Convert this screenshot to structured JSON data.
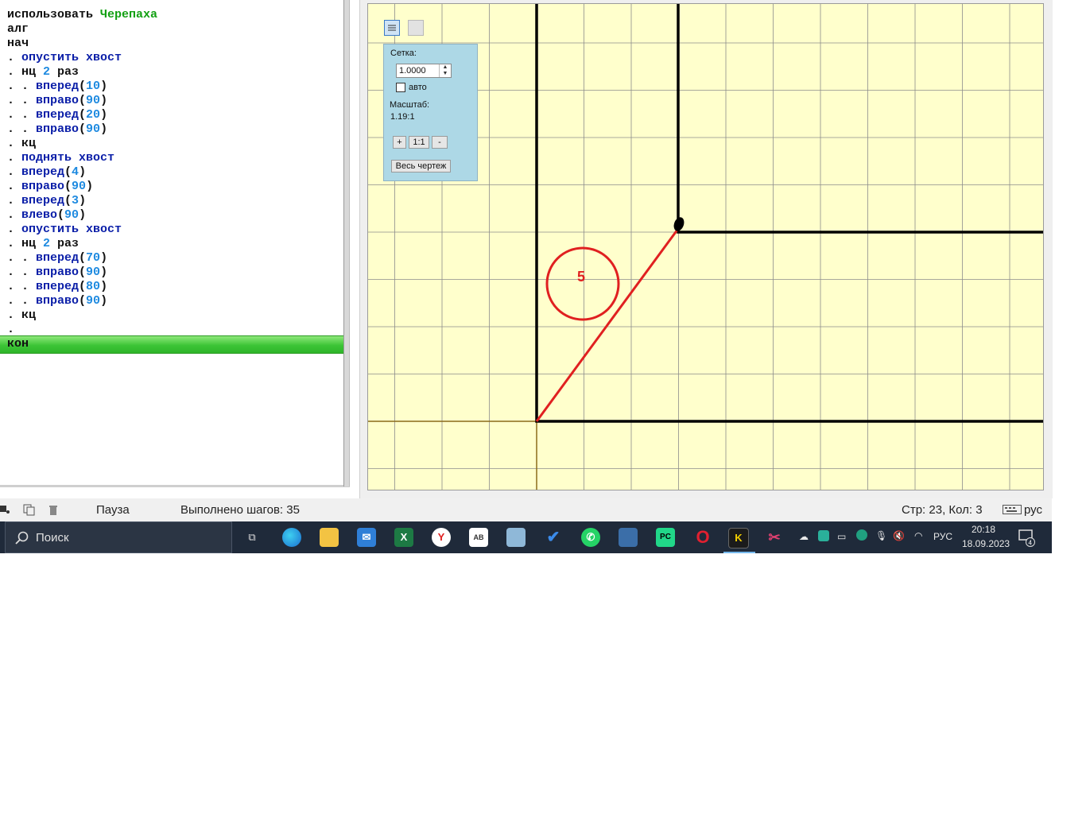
{
  "editor": {
    "lines": [
      [
        {
          "t": "использовать ",
          "c": ""
        },
        {
          "t": "Черепаха",
          "c": "grn"
        }
      ],
      [
        {
          "t": "алг",
          "c": ""
        }
      ],
      [
        {
          "t": "нач",
          "c": ""
        }
      ],
      [
        {
          "t": ". ",
          "c": "dot"
        },
        {
          "t": "опустить хвост",
          "c": "kw"
        }
      ],
      [
        {
          "t": ". нц ",
          "c": ""
        },
        {
          "t": "2",
          "c": "num"
        },
        {
          "t": " раз",
          "c": ""
        }
      ],
      [
        {
          "t": ". . ",
          "c": "dot"
        },
        {
          "t": "вперед",
          "c": "kw"
        },
        {
          "t": "(",
          "c": ""
        },
        {
          "t": "10",
          "c": "num"
        },
        {
          "t": ")",
          "c": ""
        }
      ],
      [
        {
          "t": ". . ",
          "c": "dot"
        },
        {
          "t": "вправо",
          "c": "kw"
        },
        {
          "t": "(",
          "c": ""
        },
        {
          "t": "90",
          "c": "num"
        },
        {
          "t": ")",
          "c": ""
        }
      ],
      [
        {
          "t": ". . ",
          "c": "dot"
        },
        {
          "t": "вперед",
          "c": "kw"
        },
        {
          "t": "(",
          "c": ""
        },
        {
          "t": "20",
          "c": "num"
        },
        {
          "t": ")",
          "c": ""
        }
      ],
      [
        {
          "t": ". . ",
          "c": "dot"
        },
        {
          "t": "вправо",
          "c": "kw"
        },
        {
          "t": "(",
          "c": ""
        },
        {
          "t": "90",
          "c": "num"
        },
        {
          "t": ")",
          "c": ""
        }
      ],
      [
        {
          "t": ". кц",
          "c": ""
        }
      ],
      [
        {
          "t": ". ",
          "c": "dot"
        },
        {
          "t": "поднять хвост",
          "c": "kw"
        }
      ],
      [
        {
          "t": ". ",
          "c": "dot"
        },
        {
          "t": "вперед",
          "c": "kw"
        },
        {
          "t": "(",
          "c": ""
        },
        {
          "t": "4",
          "c": "num"
        },
        {
          "t": ")",
          "c": ""
        }
      ],
      [
        {
          "t": ". ",
          "c": "dot"
        },
        {
          "t": "вправо",
          "c": "kw"
        },
        {
          "t": "(",
          "c": ""
        },
        {
          "t": "90",
          "c": "num"
        },
        {
          "t": ")",
          "c": ""
        }
      ],
      [
        {
          "t": ". ",
          "c": "dot"
        },
        {
          "t": "вперед",
          "c": "kw"
        },
        {
          "t": "(",
          "c": ""
        },
        {
          "t": "3",
          "c": "num"
        },
        {
          "t": ")",
          "c": ""
        }
      ],
      [
        {
          "t": ". ",
          "c": "dot"
        },
        {
          "t": "влево",
          "c": "kw"
        },
        {
          "t": "(",
          "c": ""
        },
        {
          "t": "90",
          "c": "num"
        },
        {
          "t": ")",
          "c": ""
        }
      ],
      [
        {
          "t": ". ",
          "c": "dot"
        },
        {
          "t": "опустить хвост",
          "c": "kw"
        }
      ],
      [
        {
          "t": ". нц ",
          "c": ""
        },
        {
          "t": "2",
          "c": "num"
        },
        {
          "t": " раз",
          "c": ""
        }
      ],
      [
        {
          "t": ". . ",
          "c": "dot"
        },
        {
          "t": "вперед",
          "c": "kw"
        },
        {
          "t": "(",
          "c": ""
        },
        {
          "t": "70",
          "c": "num"
        },
        {
          "t": ")",
          "c": ""
        }
      ],
      [
        {
          "t": ". . ",
          "c": "dot"
        },
        {
          "t": "вправо",
          "c": "kw"
        },
        {
          "t": "(",
          "c": ""
        },
        {
          "t": "90",
          "c": "num"
        },
        {
          "t": ")",
          "c": ""
        }
      ],
      [
        {
          "t": ". . ",
          "c": "dot"
        },
        {
          "t": "вперед",
          "c": "kw"
        },
        {
          "t": "(",
          "c": ""
        },
        {
          "t": "80",
          "c": "num"
        },
        {
          "t": ")",
          "c": ""
        }
      ],
      [
        {
          "t": ". . ",
          "c": "dot"
        },
        {
          "t": "вправо",
          "c": "kw"
        },
        {
          "t": "(",
          "c": ""
        },
        {
          "t": "90",
          "c": "num"
        },
        {
          "t": ")",
          "c": ""
        }
      ],
      [
        {
          "t": ". кц",
          "c": ""
        }
      ],
      [
        {
          "t": ".",
          "c": ""
        }
      ]
    ],
    "end_line": "кон"
  },
  "canvas": {
    "annotation_label": "5",
    "annotation_color": "#e02020",
    "background_color": "#ffffcc"
  },
  "grid_panel": {
    "grid_label": "Сетка:",
    "grid_value": "1.0000",
    "auto_label": "авто",
    "auto_checked": false,
    "scale_label": "Масштаб:",
    "scale_value": "1.19:1",
    "zoom_in_label": "+",
    "zoom_reset_label": "1:1",
    "zoom_out_label": "-",
    "fit_all_label": "Весь чертеж"
  },
  "status": {
    "state": "Пауза",
    "steps": "Выполнено шагов: 35",
    "cursor_pos": "Стр: 23, Кол: 3",
    "keyboard_layout": "рус"
  },
  "taskbar": {
    "search_placeholder": "Поиск",
    "tray_lang": "РУС",
    "time": "20:18",
    "date": "18.09.2023",
    "notification_count": "4"
  }
}
